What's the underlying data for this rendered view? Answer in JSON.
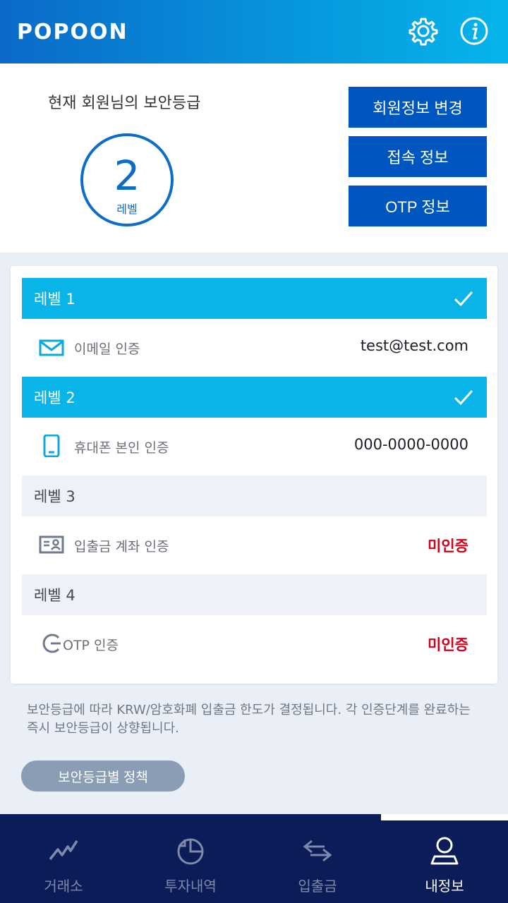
{
  "header": {
    "logo": "POPOON",
    "settings_icon": "gear-icon",
    "info_icon": "info-icon",
    "color": "#0798dd"
  },
  "security": {
    "title": "현재 회원님의 보안등급",
    "level_number": "2",
    "level_unit": "레벨",
    "buttons": {
      "member_info": "회원정보 변경",
      "access_info": "접속 정보",
      "otp_info": "OTP 정보"
    }
  },
  "levels": [
    {
      "label": "레벨 1",
      "completed": true,
      "item_label": "이메일 인증",
      "item_value": "test@test.com",
      "icon": "mail-icon"
    },
    {
      "label": "레벨 2",
      "completed": true,
      "item_label": "휴대폰 본인 인증",
      "item_value": "000-0000-0000",
      "icon": "phone-icon"
    },
    {
      "label": "레벨 3",
      "completed": false,
      "item_label": "입출금 계좌 인증",
      "item_value": "미인증",
      "icon": "id-card-icon"
    },
    {
      "label": "레벨 4",
      "completed": false,
      "item_label": "OTP 인증",
      "item_value": "미인증",
      "icon": "otp-icon"
    }
  ],
  "notice": "보안등급에 따라 KRW/암호화폐 입출금 한도가 결정됩니다. 각 인증단계를 완료하는 즉시 보안등급이 상향됩니다.",
  "policy_button": "보안등급별 정책",
  "tabs": [
    {
      "label": "거래소",
      "icon": "chart-line-icon",
      "active": false
    },
    {
      "label": "투자내역",
      "icon": "pie-chart-icon",
      "active": false
    },
    {
      "label": "입출금",
      "icon": "transfer-arrows-icon",
      "active": false
    },
    {
      "label": "내정보",
      "icon": "user-icon",
      "active": true
    }
  ],
  "colors": {
    "accent": "#0056bf",
    "level_done": "#08b4e8",
    "unverified": "#d0021b",
    "tab_bar": "#0b1c58"
  }
}
